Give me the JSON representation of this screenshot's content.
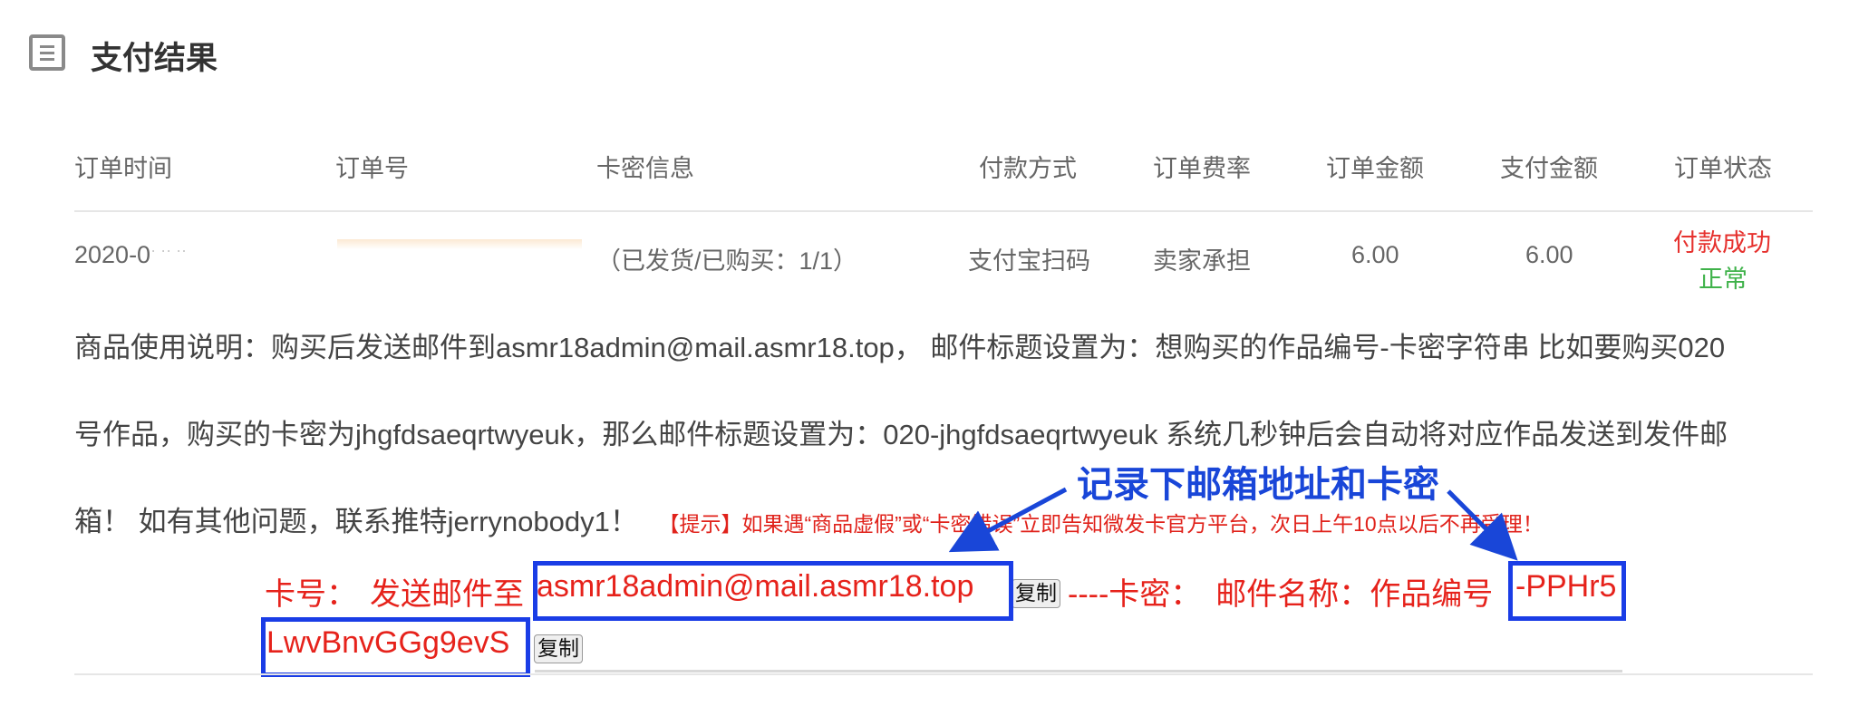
{
  "page": {
    "title": "支付结果",
    "title_icon": "list-document-icon"
  },
  "table": {
    "headers": [
      "订单时间",
      "订单号",
      "卡密信息",
      "付款方式",
      "订单费率",
      "订单金额",
      "支付金额",
      "订单状态"
    ],
    "row": {
      "time": "2020-0",
      "time_fragment": "· ·· ··",
      "order_no": "",
      "card_info": "（已发货/已购买：1/1）",
      "pay_method": "支付宝扫码",
      "fee_rate": "卖家承担",
      "order_amount": "6.00",
      "paid_amount": "6.00",
      "status_paid": "付款成功",
      "status_normal": "正常"
    }
  },
  "description": {
    "line1": "商品使用说明：购买后发送邮件到asmr18admin@mail.asmr18.top，  邮件标题设置为：想购买的作品编号-卡密字符串 比如要购买020",
    "line2": "号作品，购买的卡密为jhgfdsaeqrtwyeuk，那么邮件标题设置为：020-jhgfdsaeqrtwyeuk 系统几秒钟后会自动将对应作品发送到发件邮",
    "line3": "箱！ 如有其他问题，联系推特jerrynobody1！",
    "tip": "【提示】如果遇“商品虚假”或“卡密错误”立即告知微发卡官方平台，次日上午10点以后不再受理！"
  },
  "card": {
    "card_no_label": "卡号：",
    "send_to_label": "发送邮件至",
    "email": "asmr18admin@mail.asmr18.top",
    "copy_label": "复制",
    "separator": "----卡密：",
    "mail_name_label": "邮件名称：作品编号",
    "code_part1": "-PPHr5",
    "code_part2": "LwvBnvGGg9evS"
  },
  "annotation": {
    "text": "记录下邮箱地址和卡密",
    "color": "#1946d8"
  },
  "colors": {
    "status_paid": "#e6312e",
    "status_normal": "#3fb24a",
    "highlight_box": "#1a3de6",
    "card_text": "#e6221b",
    "order_no": "#f2a65a"
  }
}
